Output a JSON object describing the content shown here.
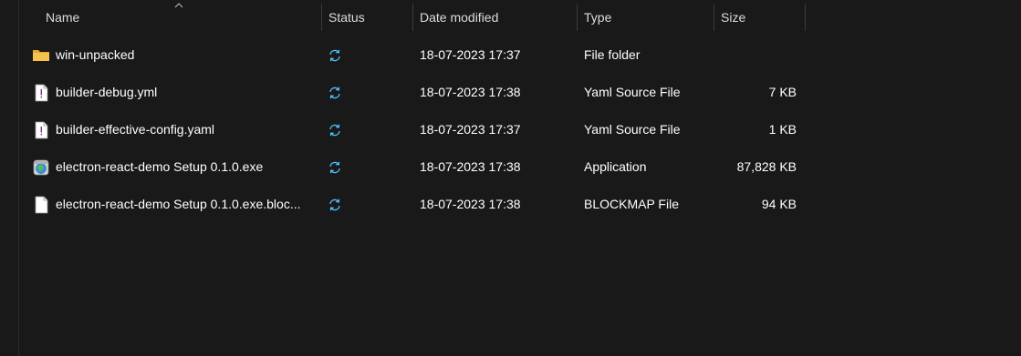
{
  "columns": {
    "name": "Name",
    "status": "Status",
    "date": "Date modified",
    "type": "Type",
    "size": "Size"
  },
  "files": [
    {
      "name": "win-unpacked",
      "status_icon": "sync-icon",
      "date": "18-07-2023 17:37",
      "type": "File folder",
      "size": "",
      "icon": "folder-icon"
    },
    {
      "name": "builder-debug.yml",
      "status_icon": "sync-icon",
      "date": "18-07-2023 17:38",
      "type": "Yaml Source File",
      "size": "7 KB",
      "icon": "yaml-file-icon"
    },
    {
      "name": "builder-effective-config.yaml",
      "status_icon": "sync-icon",
      "date": "18-07-2023 17:37",
      "type": "Yaml Source File",
      "size": "1 KB",
      "icon": "yaml-file-icon"
    },
    {
      "name": "electron-react-demo Setup 0.1.0.exe",
      "status_icon": "sync-icon",
      "date": "18-07-2023 17:38",
      "type": "Application",
      "size": "87,828 KB",
      "icon": "installer-icon"
    },
    {
      "name": "electron-react-demo Setup 0.1.0.exe.bloc...",
      "status_icon": "sync-icon",
      "date": "18-07-2023 17:38",
      "type": "BLOCKMAP File",
      "size": "94 KB",
      "icon": "blank-file-icon"
    }
  ],
  "colors": {
    "background": "#191919",
    "text": "#ffffff",
    "header_text": "#dcdcdc",
    "sync_accent": "#4cc2ff",
    "folder": "#f4c34d"
  }
}
